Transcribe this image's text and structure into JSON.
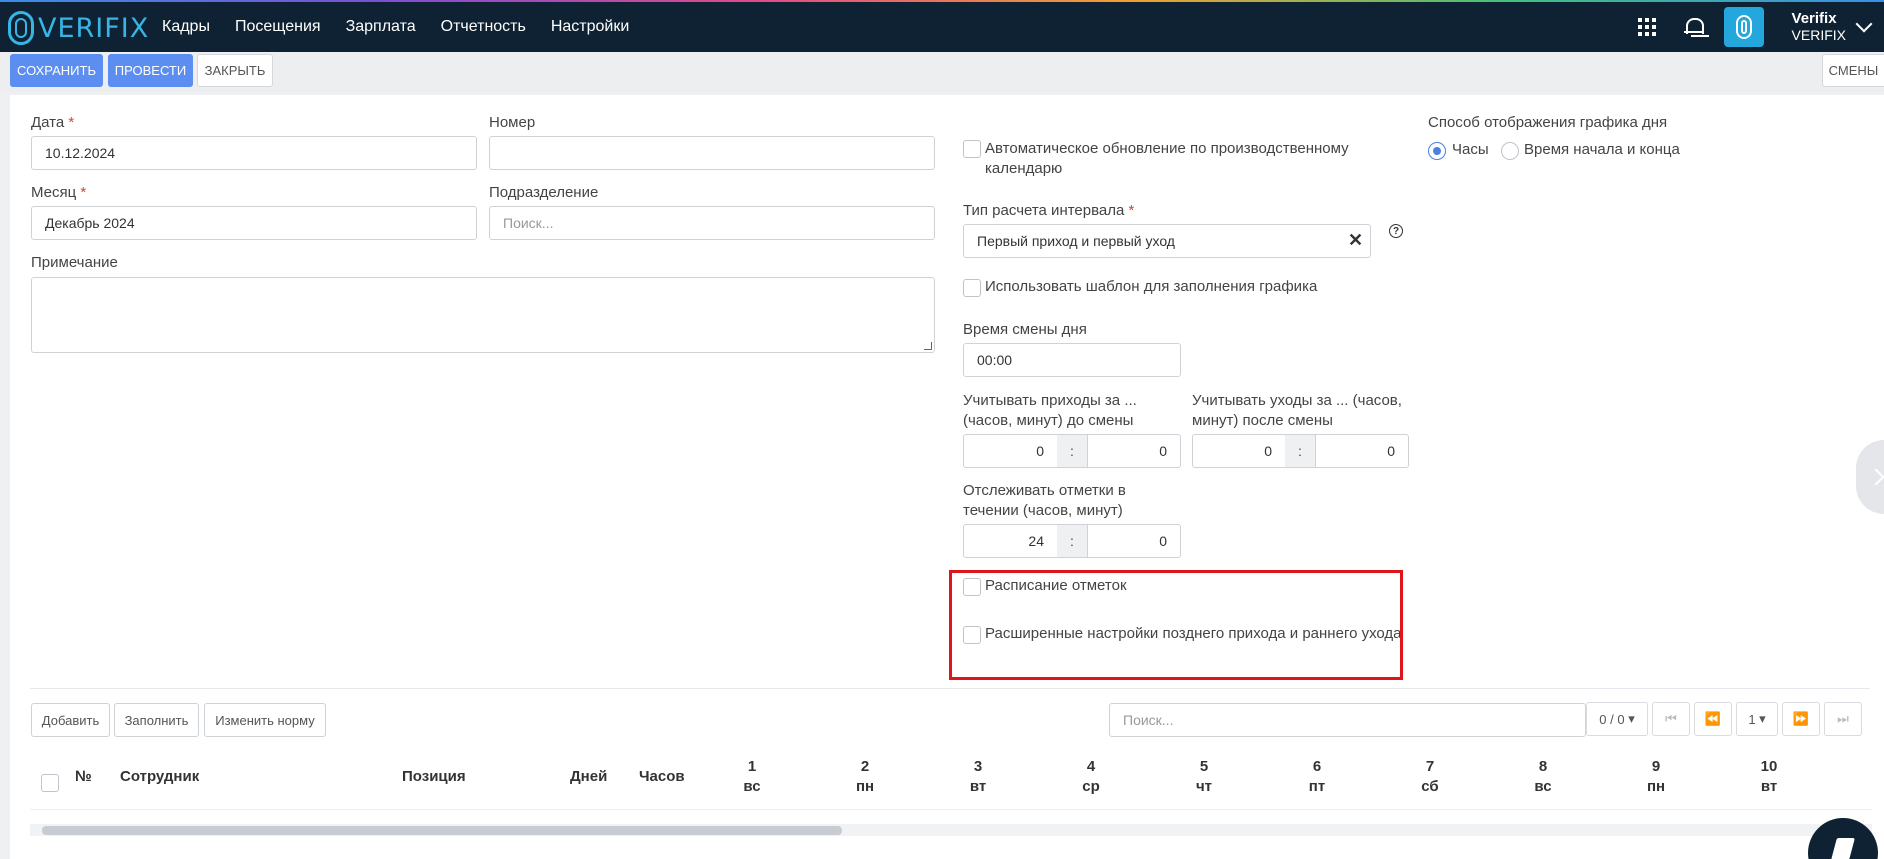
{
  "brand": {
    "logo_text": "VERIFIX"
  },
  "nav": {
    "items": [
      "Кадры",
      "Посещения",
      "Зарплата",
      "Отчетность",
      "Настройки"
    ]
  },
  "user": {
    "name": "Verifix",
    "company": "VERIFIX"
  },
  "toolbar": {
    "save": "СОХРАНИТЬ",
    "post": "ПРОВЕСТИ",
    "close": "ЗАКРЫТЬ",
    "shifts": "СМЕНЫ"
  },
  "form": {
    "date_label": "Дата",
    "date_value": "10.12.2024",
    "number_label": "Номер",
    "number_value": "",
    "month_label": "Месяц",
    "month_value": "Декабрь 2024",
    "department_label": "Подразделение",
    "department_placeholder": "Поиск...",
    "note_label": "Примечание",
    "auto_update_label": "Автоматическое обновление по производственному календарю",
    "interval_type_label": "Тип расчета интервала",
    "interval_type_value": "Первый приход и первый уход",
    "use_template_label": "Использовать шаблон для заполнения графика",
    "shift_time_label": "Время смены дня",
    "shift_time_value": "00:00",
    "arrivals_before_label": "Учитывать приходы за ... (часов, минут) до смены",
    "arrivals_before_hours": "0",
    "arrivals_before_minutes": "0",
    "departures_after_label": "Учитывать уходы за ... (часов, минут) после смены",
    "departures_after_hours": "0",
    "departures_after_minutes": "0",
    "track_marks_label": "Отслеживать отметки в течении (часов, минут)",
    "track_marks_hours": "24",
    "track_marks_minutes": "0",
    "mark_schedule_label": "Расписание отметок",
    "advanced_late_label": "Расширенные настройки позднего прихода и раннего ухода",
    "display_mode_label": "Способ отображения графика дня",
    "display_hours": "Часы",
    "display_start_end": "Время начала и конца"
  },
  "grid_toolbar": {
    "add": "Добавить",
    "fill": "Заполнить",
    "change_norm": "Изменить норму",
    "search_placeholder": "Поиск...",
    "counter": "0 / 0",
    "page": "1"
  },
  "table": {
    "headers": {
      "num": "№",
      "employee": "Сотрудник",
      "position": "Позиция",
      "days": "Дней",
      "hours": "Часов"
    },
    "day_columns": [
      {
        "day": "1",
        "dow": "вс"
      },
      {
        "day": "2",
        "dow": "пн"
      },
      {
        "day": "3",
        "dow": "вт"
      },
      {
        "day": "4",
        "dow": "ср"
      },
      {
        "day": "5",
        "dow": "чт"
      },
      {
        "day": "6",
        "dow": "пт"
      },
      {
        "day": "7",
        "dow": "сб"
      },
      {
        "day": "8",
        "dow": "вс"
      },
      {
        "day": "9",
        "dow": "пн"
      },
      {
        "day": "10",
        "dow": "вт"
      }
    ]
  }
}
